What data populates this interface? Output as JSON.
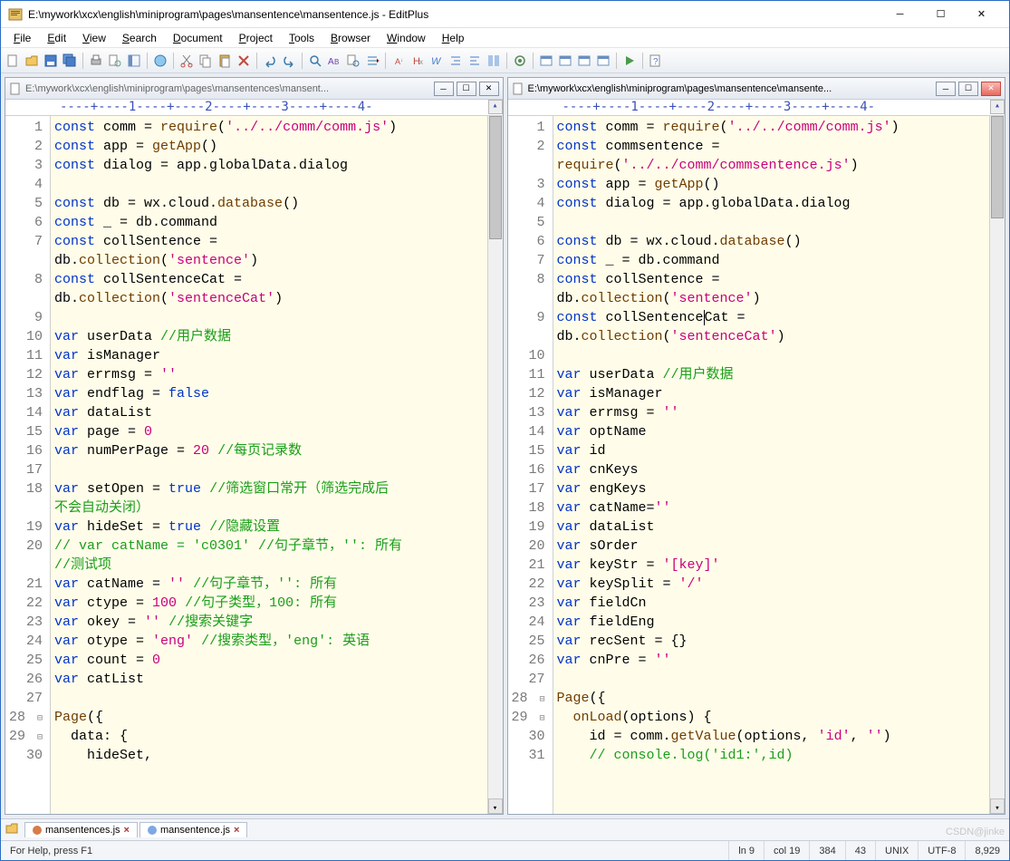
{
  "window": {
    "title": "E:\\mywork\\xcx\\english\\miniprogram\\pages\\mansentence\\mansentence.js - EditPlus"
  },
  "menu": {
    "file": "File",
    "edit": "Edit",
    "view": "View",
    "search": "Search",
    "document": "Document",
    "project": "Project",
    "tools": "Tools",
    "browser": "Browser",
    "window": "Window",
    "help": "Help"
  },
  "panes": {
    "left": {
      "path": "E:\\mywork\\xcx\\english\\miniprogram\\pages\\mansentences\\mansent...",
      "ruler": "----+----1----+----2----+----3----+----4-",
      "active": false
    },
    "right": {
      "path": "E:\\mywork\\xcx\\english\\miniprogram\\pages\\mansentence\\mansente...",
      "ruler": "----+----1----+----2----+----3----+----4-",
      "active": true
    }
  },
  "left_code": {
    "lines": [
      {
        "n": "1",
        "h": "<span class=kw>const</span> comm = <span class=fn>require</span>(<span class=str>'../../comm/comm.js'</span>)"
      },
      {
        "n": "2",
        "h": "<span class=kw>const</span> app = <span class=fn>getApp</span>()"
      },
      {
        "n": "3",
        "h": "<span class=kw>const</span> dialog = app.globalData.dialog"
      },
      {
        "n": "4",
        "h": ""
      },
      {
        "n": "5",
        "h": "<span class=kw>const</span> db = wx.cloud.<span class=fn>database</span>()"
      },
      {
        "n": "6",
        "h": "<span class=kw>const</span> _ = db.command"
      },
      {
        "n": "7",
        "h": "<span class=kw>const</span> collSentence ="
      },
      {
        "n": "",
        "h": "db.<span class=fn>collection</span>(<span class=str>'sentence'</span>)"
      },
      {
        "n": "8",
        "h": "<span class=kw>const</span> collSentenceCat ="
      },
      {
        "n": "",
        "h": "db.<span class=fn>collection</span>(<span class=str>'sentenceCat'</span>)"
      },
      {
        "n": "9",
        "h": ""
      },
      {
        "n": "10",
        "h": "<span class=kw>var</span> userData <span class=cmt>//用户数据</span>"
      },
      {
        "n": "11",
        "h": "<span class=kw>var</span> isManager"
      },
      {
        "n": "12",
        "h": "<span class=kw>var</span> errmsg = <span class=str>''</span>"
      },
      {
        "n": "13",
        "h": "<span class=kw>var</span> endflag = <span class=kw>false</span>"
      },
      {
        "n": "14",
        "h": "<span class=kw>var</span> dataList"
      },
      {
        "n": "15",
        "h": "<span class=kw>var</span> page = <span class=num>0</span>"
      },
      {
        "n": "16",
        "h": "<span class=kw>var</span> numPerPage = <span class=num>20</span> <span class=cmt>//每页记录数</span>"
      },
      {
        "n": "17",
        "h": ""
      },
      {
        "n": "18",
        "h": "<span class=kw>var</span> setOpen = <span class=kw>true</span> <span class=cmt>//筛选窗口常开（筛选完成后</span>"
      },
      {
        "n": "",
        "h": "<span class=cmt>不会自动关闭）</span>"
      },
      {
        "n": "19",
        "h": "<span class=kw>var</span> hideSet = <span class=kw>true</span> <span class=cmt>//隐藏设置</span>"
      },
      {
        "n": "20",
        "h": "<span class=cmt>// var catName = 'c0301' //句子章节，'': 所有</span>"
      },
      {
        "n": "",
        "h": "<span class=cmt>//测试项</span>"
      },
      {
        "n": "21",
        "h": "<span class=kw>var</span> catName = <span class=str>''</span> <span class=cmt>//句子章节，'': 所有</span>"
      },
      {
        "n": "22",
        "h": "<span class=kw>var</span> ctype = <span class=num>100</span> <span class=cmt>//句子类型，100: 所有</span>"
      },
      {
        "n": "23",
        "h": "<span class=kw>var</span> okey = <span class=str>''</span> <span class=cmt>//搜索关键字</span>"
      },
      {
        "n": "24",
        "h": "<span class=kw>var</span> otype = <span class=str>'eng'</span> <span class=cmt>//搜索类型，'eng': 英语</span>"
      },
      {
        "n": "25",
        "h": "<span class=kw>var</span> count = <span class=num>0</span>"
      },
      {
        "n": "26",
        "h": "<span class=kw>var</span> catList"
      },
      {
        "n": "27",
        "h": ""
      },
      {
        "n": "28",
        "h": "<span class=fn>Page</span>({",
        "fold": true
      },
      {
        "n": "29",
        "h": "  data: {",
        "fold": true
      },
      {
        "n": "30",
        "h": "    hideSet,"
      }
    ]
  },
  "right_code": {
    "lines": [
      {
        "n": "1",
        "h": "<span class=kw>const</span> comm = <span class=fn>require</span>(<span class=str>'../../comm/comm.js'</span>)"
      },
      {
        "n": "2",
        "h": "<span class=kw>const</span> commsentence ="
      },
      {
        "n": "",
        "h": "<span class=fn>require</span>(<span class=str>'../../comm/commsentence.js'</span>)"
      },
      {
        "n": "3",
        "h": "<span class=kw>const</span> app = <span class=fn>getApp</span>()"
      },
      {
        "n": "4",
        "h": "<span class=kw>const</span> dialog = app.globalData.dialog"
      },
      {
        "n": "5",
        "h": ""
      },
      {
        "n": "6",
        "h": "<span class=kw>const</span> db = wx.cloud.<span class=fn>database</span>()"
      },
      {
        "n": "7",
        "h": "<span class=kw>const</span> _ = db.command"
      },
      {
        "n": "8",
        "h": "<span class=kw>const</span> collSentence ="
      },
      {
        "n": "",
        "h": "db.<span class=fn>collection</span>(<span class=str>'sentence'</span>)"
      },
      {
        "n": "9",
        "h": "<span class=kw>const</span> collSentence<span class=cursor></span>Cat ="
      },
      {
        "n": "",
        "h": "db.<span class=fn>collection</span>(<span class=str>'sentenceCat'</span>)"
      },
      {
        "n": "10",
        "h": ""
      },
      {
        "n": "11",
        "h": "<span class=kw>var</span> userData <span class=cmt>//用户数据</span>"
      },
      {
        "n": "12",
        "h": "<span class=kw>var</span> isManager"
      },
      {
        "n": "13",
        "h": "<span class=kw>var</span> errmsg = <span class=str>''</span>"
      },
      {
        "n": "14",
        "h": "<span class=kw>var</span> optName"
      },
      {
        "n": "15",
        "h": "<span class=kw>var</span> id"
      },
      {
        "n": "16",
        "h": "<span class=kw>var</span> cnKeys"
      },
      {
        "n": "17",
        "h": "<span class=kw>var</span> engKeys"
      },
      {
        "n": "18",
        "h": "<span class=kw>var</span> catName=<span class=str>''</span>"
      },
      {
        "n": "19",
        "h": "<span class=kw>var</span> dataList"
      },
      {
        "n": "20",
        "h": "<span class=kw>var</span> sOrder"
      },
      {
        "n": "21",
        "h": "<span class=kw>var</span> keyStr = <span class=str>'[key]'</span>"
      },
      {
        "n": "22",
        "h": "<span class=kw>var</span> keySplit = <span class=str>'/'</span>"
      },
      {
        "n": "23",
        "h": "<span class=kw>var</span> fieldCn"
      },
      {
        "n": "24",
        "h": "<span class=kw>var</span> fieldEng"
      },
      {
        "n": "25",
        "h": "<span class=kw>var</span> recSent = {}"
      },
      {
        "n": "26",
        "h": "<span class=kw>var</span> cnPre = <span class=str>''</span>"
      },
      {
        "n": "27",
        "h": ""
      },
      {
        "n": "28",
        "h": "<span class=fn>Page</span>({",
        "fold": true
      },
      {
        "n": "29",
        "h": "  <span class=fn>onLoad</span>(options) {",
        "fold": true
      },
      {
        "n": "30",
        "h": "    id = comm.<span class=fn>getValue</span>(options, <span class=str>'id'</span>, <span class=str>''</span>)"
      },
      {
        "n": "31",
        "h": "    <span class=cmt>// console.log('id1:',id)</span>"
      }
    ]
  },
  "tabs": {
    "t1": "mansentences.js",
    "t2": "mansentence.js"
  },
  "status": {
    "help": "For Help, press F1",
    "ln": "ln 9",
    "col": "col 19",
    "lines": "384",
    "sel": "43",
    "eol": "UNIX",
    "enc": "UTF-8",
    "size": "8,929"
  },
  "watermark": "CSDN@jinke"
}
